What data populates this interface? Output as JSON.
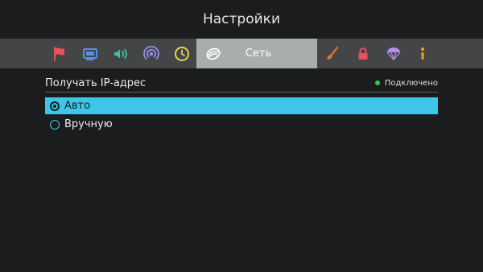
{
  "header": {
    "title": "Настройки"
  },
  "tabs": [
    {
      "icon": "flag-icon",
      "color": "#e8525b"
    },
    {
      "icon": "tv-icon",
      "color": "#5a8fe0"
    },
    {
      "icon": "sound-icon",
      "color": "#35c9a0"
    },
    {
      "icon": "broadcast-icon",
      "color": "#8e8ff0"
    },
    {
      "icon": "clock-icon",
      "color": "#e8d24a"
    },
    {
      "icon": "network-icon",
      "color": "#ffffff",
      "label": "Сеть",
      "active": true
    },
    {
      "icon": "brush-icon",
      "color": "#e8772e"
    },
    {
      "icon": "lock-icon",
      "color": "#e8525b"
    },
    {
      "icon": "parachute-icon",
      "color": "#b48ee8"
    },
    {
      "icon": "info-icon",
      "color": "#f0a020"
    }
  ],
  "section": {
    "title": "Получать IP-адрес",
    "status": "Подключено",
    "status_color": "#2fd14a"
  },
  "options": [
    {
      "label": "Авто",
      "selected": true
    },
    {
      "label": "Вручную",
      "selected": false
    }
  ],
  "accent_color": "#3ec6e8"
}
